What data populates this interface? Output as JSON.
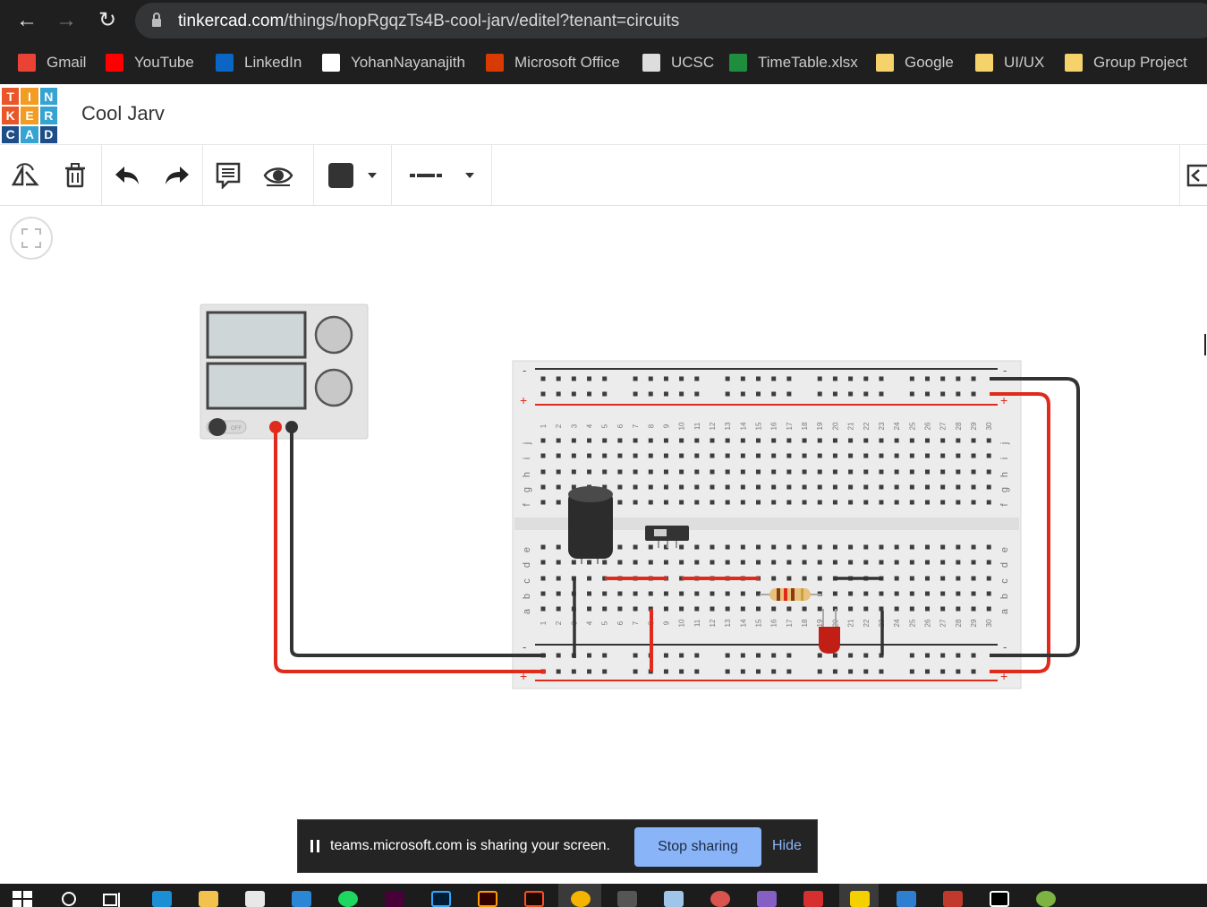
{
  "browser": {
    "url_domain": "tinkercad.com",
    "url_path": "/things/hopRgqzTs4B-cool-jarv/editel?tenant=circuits",
    "bookmarks": [
      {
        "label": "Gmail",
        "icon": "gmail-icon",
        "color": "#ea4335"
      },
      {
        "label": "YouTube",
        "icon": "youtube-icon",
        "color": "#ff0000"
      },
      {
        "label": "LinkedIn",
        "icon": "linkedin-icon",
        "color": "#0a66c2"
      },
      {
        "label": "YohanNayanajith",
        "icon": "github-icon",
        "color": "#ffffff"
      },
      {
        "label": "Microsoft Office",
        "icon": "office-icon",
        "color": "#d83b01"
      },
      {
        "label": "UCSC",
        "icon": "ucsc-icon",
        "color": "#dddddd"
      },
      {
        "label": "TimeTable.xlsx",
        "icon": "excel-icon",
        "color": "#1e8e3e"
      },
      {
        "label": "Google",
        "icon": "folder-icon",
        "color": "#f6d26b"
      },
      {
        "label": "UI/UX",
        "icon": "folder-icon",
        "color": "#f6d26b"
      },
      {
        "label": "Group Project",
        "icon": "folder-icon",
        "color": "#f6d26b"
      }
    ]
  },
  "app": {
    "logo_letters": [
      "T",
      "I",
      "N",
      "K",
      "E",
      "R",
      "C",
      "A",
      "D"
    ],
    "logo_colors": [
      "#e8562a",
      "#f29c23",
      "#37a3d2",
      "#e8562a",
      "#f29c23",
      "#37a3d2",
      "#1d4e89",
      "#37a3d2",
      "#1d4e89"
    ],
    "design_title": "Cool Jarv"
  },
  "toolbar": {
    "tools": [
      "rotate-icon",
      "delete-icon",
      "undo-icon",
      "redo-icon",
      "notes-icon",
      "visibility-icon"
    ],
    "color_swatch": "#333333"
  },
  "breadboard": {
    "row_labels_top": [
      "j",
      "i",
      "h",
      "g",
      "f"
    ],
    "row_labels_bottom": [
      "e",
      "d",
      "c",
      "b",
      "a"
    ],
    "column_numbers": [
      "1",
      "2",
      "3",
      "4",
      "5",
      "6",
      "7",
      "8",
      "9",
      "10",
      "11",
      "12",
      "13",
      "14",
      "15",
      "16",
      "17",
      "18",
      "19",
      "20",
      "21",
      "22",
      "23",
      "24",
      "25",
      "26",
      "27",
      "28",
      "29",
      "30"
    ],
    "rail_minus": "-",
    "rail_plus": "+"
  },
  "power_supply": {
    "switch_label": "OFF"
  },
  "share_banner": {
    "message": "teams.microsoft.com is sharing your screen.",
    "stop_label": "Stop sharing",
    "hide_label": "Hide"
  }
}
